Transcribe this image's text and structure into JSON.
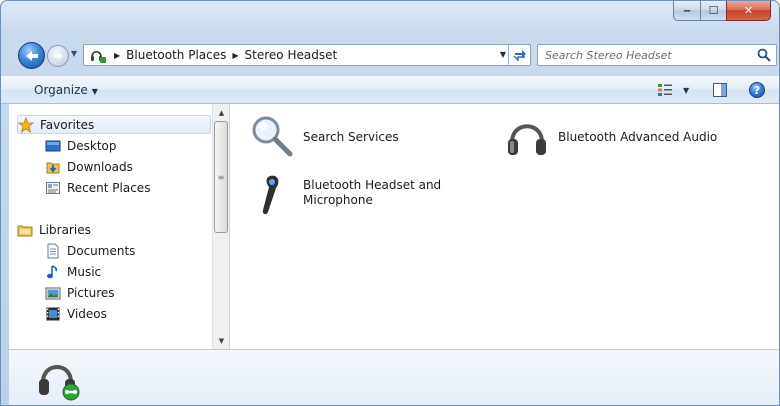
{
  "window": {
    "caption": {
      "minimize": "‒",
      "maximize": "☐",
      "close": "✕"
    }
  },
  "nav": {
    "breadcrumbs": [
      "Bluetooth Places",
      "Stereo Headset"
    ],
    "search_placeholder": "Search Stereo Headset"
  },
  "command_bar": {
    "organize_label": "Organize"
  },
  "sidebar": {
    "favorites_label": "Favorites",
    "favorites": [
      {
        "label": "Desktop",
        "icon": "desktop-icon"
      },
      {
        "label": "Downloads",
        "icon": "downloads-icon"
      },
      {
        "label": "Recent Places",
        "icon": "recent-places-icon"
      }
    ],
    "libraries_label": "Libraries",
    "libraries": [
      {
        "label": "Documents",
        "icon": "documents-icon"
      },
      {
        "label": "Music",
        "icon": "music-icon"
      },
      {
        "label": "Pictures",
        "icon": "pictures-icon"
      },
      {
        "label": "Videos",
        "icon": "videos-icon"
      }
    ]
  },
  "content": {
    "items": [
      {
        "label": "Search Services",
        "icon": "magnifier-icon"
      },
      {
        "label": "Bluetooth Advanced Audio",
        "icon": "headphones-icon"
      },
      {
        "label": "Bluetooth Headset and Microphone",
        "icon": "earpiece-icon"
      }
    ]
  },
  "details": {
    "icon": "headphones-connected-icon"
  },
  "colors": {
    "accent": "#3b86d6",
    "frame": "#bcd0e8",
    "close": "#c7432b"
  }
}
